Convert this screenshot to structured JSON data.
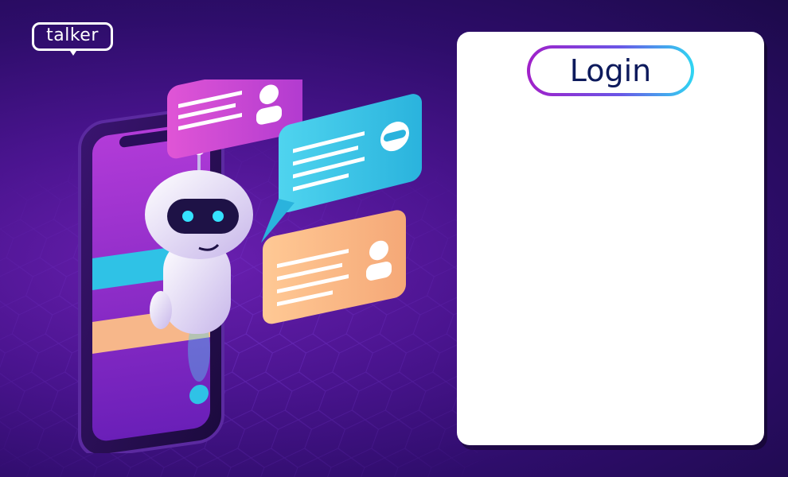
{
  "brand": {
    "logo_text": "talker"
  },
  "login_card": {
    "title": "Login"
  },
  "colors": {
    "background": "#3a0f7e",
    "pill_gradient_start": "#a120c9",
    "pill_gradient_end": "#2fd6f2",
    "login_text": "#0d1a5c",
    "bubble_pink": "#d14bd6",
    "bubble_cyan": "#3ec9e6",
    "bubble_peach": "#f7b78a"
  }
}
